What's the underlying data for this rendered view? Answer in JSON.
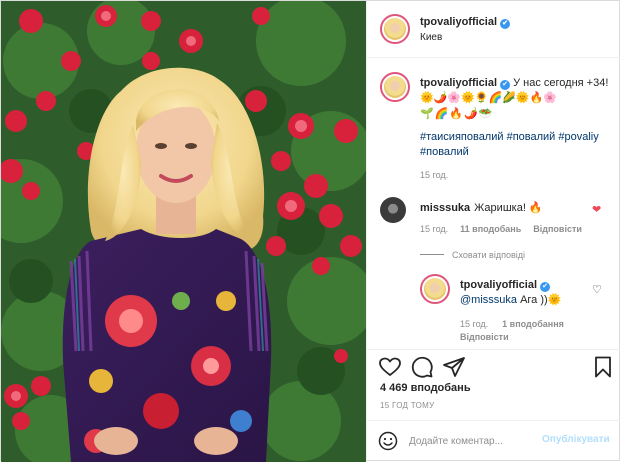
{
  "post": {
    "username": "tpovaliyofficial",
    "location": "Киев",
    "verified_mark": "✔"
  },
  "caption": {
    "username": "tpovaliyofficial",
    "text": "У нас сегодня +34!",
    "emoji_line1": "🌞🌶️🌸🌞🌻🌈🌽🌞🔥🌸",
    "emoji_line2": "🌱🌈🔥🌶️🥗",
    "hashtags": "#таисияповалий #повалий #povaliy #повалий",
    "time": "15 год."
  },
  "comment1": {
    "username": "misssuka",
    "text": "Жаришка! 🔥",
    "time": "15 год.",
    "likes": "11 вподобань",
    "reply_label": "Відповісти"
  },
  "hide_replies": "Сховати відповіді",
  "reply1": {
    "username": "tpovaliyofficial",
    "mention": "@misssuka",
    "text": " Ага ))🌞",
    "time": "15 год.",
    "likes": "1 вподобання",
    "reply_label": "Відповісти"
  },
  "actions": {
    "likes_count": "4 469 вподобань",
    "posted_ago": "15 ГОД ТОМУ"
  },
  "add_comment": {
    "placeholder": "Додайте коментар...",
    "publish_label": "Опублікувати"
  },
  "colors": {
    "brand_blue": "#3897f0",
    "heart_red": "#ed4956",
    "link_blue": "#00376b",
    "publish_disabled": "#b2dffc"
  },
  "icons": [
    "verified-badge-icon",
    "heart-icon",
    "comment-icon",
    "share-icon",
    "bookmark-icon",
    "smile-icon"
  ]
}
